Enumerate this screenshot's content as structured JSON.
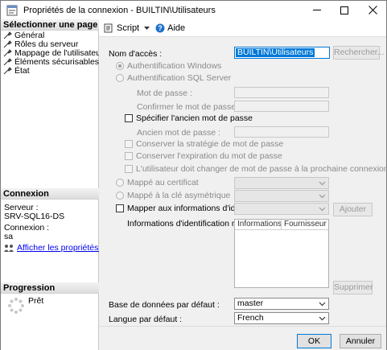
{
  "window": {
    "title": "Propriétés de la connexion - BUILTIN\\Utilisateurs",
    "minimize": "—",
    "maximize": "☐",
    "close": "✕"
  },
  "left": {
    "select_page_header": "Sélectionner une page",
    "pages": [
      {
        "label": "Général",
        "icon": "wrench-icon"
      },
      {
        "label": "Rôles du serveur",
        "icon": "wrench-icon"
      },
      {
        "label": "Mappage de l'utilisateur",
        "icon": "wrench-icon"
      },
      {
        "label": "Éléments sécurisables",
        "icon": "wrench-icon"
      },
      {
        "label": "État",
        "icon": "wrench-icon"
      }
    ],
    "connection_header": "Connexion",
    "server_label": "Serveur :",
    "server_value": "SRV-SQL16-DS",
    "connection_label": "Connexion :",
    "connection_value": "sa",
    "view_props_link": "Afficher les propriétés de connexion",
    "progress_header": "Progression",
    "progress_status": "Prêt"
  },
  "toolbar": {
    "script_label": "Script",
    "help_label": "Aide"
  },
  "form": {
    "login_name_label": "Nom d'accès :",
    "login_name_value": "BUILTIN\\Utilisateurs",
    "search_button": "Rechercher...",
    "windows_auth": "Authentification Windows",
    "sql_auth": "Authentification SQL Server",
    "password_label": "Mot de passe :",
    "confirm_password_label": "Confirmer le mot de passe :",
    "specify_old_password": "Spécifier l'ancien mot de passe",
    "old_password_label": "Ancien mot de passe :",
    "enforce_policy": "Conserver la stratégie de mot de passe",
    "enforce_expiration": "Conserver l'expiration du mot de passe",
    "must_change": "L'utilisateur doit changer de mot de passe à la prochaine connexion",
    "mapped_certificate": "Mappé au certificat",
    "mapped_asymmetric_key": "Mappé à la clé asymétrique",
    "map_to_credential": "Mapper aux informations d'identification",
    "add_button": "Ajouter",
    "mapped_credentials_label": "Informations d'identification mappées",
    "credentials_columns": [
      "Informations ...",
      "Fournisseur"
    ],
    "remove_button": "Supprimer",
    "default_database_label": "Base de données par défaut :",
    "default_database_value": "master",
    "default_language_label": "Langue par défaut :",
    "default_language_value": "French"
  },
  "footer": {
    "ok_button": "OK",
    "cancel_button": "Annuler"
  },
  "colors": {
    "accent": "#0078d7",
    "link": "#0000ee",
    "disabled_text": "#8a8a8a"
  }
}
